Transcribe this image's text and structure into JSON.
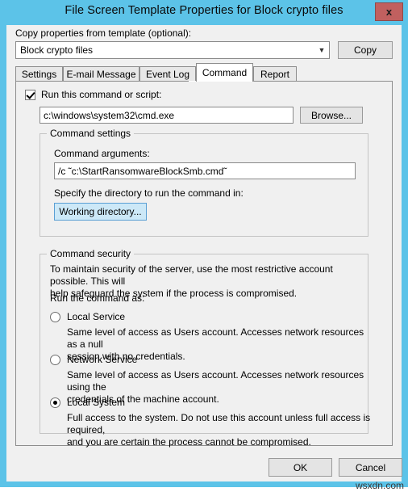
{
  "window": {
    "title": "File Screen Template Properties for Block crypto files",
    "close_label": "x",
    "frame_color": "#5cc3e8",
    "close_color": "#c1605f"
  },
  "copy_section": {
    "label": "Copy properties from template (optional):",
    "selected_template": "Block crypto files",
    "dropdown_arrow": "chevron-down-icon",
    "copy_button": "Copy"
  },
  "tabs": [
    {
      "label": "Settings",
      "active": false
    },
    {
      "label": "E-mail Message",
      "active": false
    },
    {
      "label": "Event Log",
      "active": false
    },
    {
      "label": "Command",
      "active": true
    },
    {
      "label": "Report",
      "active": false
    }
  ],
  "command_tab": {
    "run_checkbox_label": "Run this command or script:",
    "run_checkbox_checked": true,
    "command_path": "c:\\windows\\system32\\cmd.exe",
    "browse_button": "Browse...",
    "settings_group_title": "Command settings",
    "arguments_label": "Command arguments:",
    "arguments_value": "/c ˜c:\\StartRansomwareBlockSmb.cmd˜",
    "directory_label": "Specify the directory to run the command in:",
    "working_directory_button": "Working directory...",
    "security_group_title": "Command security",
    "security_text_line1": "To maintain security of the server, use the most restrictive account possible. This will",
    "security_text_line2": "help safeguard the system if the process is compromised.",
    "run_as_label": "Run the command as:",
    "accounts": [
      {
        "label": "Local Service",
        "selected": false,
        "desc_line1": "Same level of access as Users account. Accesses network resources as a null",
        "desc_line2": "session with no credentials."
      },
      {
        "label": "Network Service",
        "selected": false,
        "desc_line1": "Same level of access as Users account. Accesses network resources using the",
        "desc_line2": "credentials of the machine account."
      },
      {
        "label": "Local System",
        "selected": true,
        "desc_line1": "Full access to the system. Do not use this account unless full access is required,",
        "desc_line2": "and you are certain the process cannot be compromised."
      }
    ]
  },
  "footer": {
    "ok_button": "OK",
    "cancel_button": "Cancel"
  },
  "watermark": "wsxdn.com"
}
